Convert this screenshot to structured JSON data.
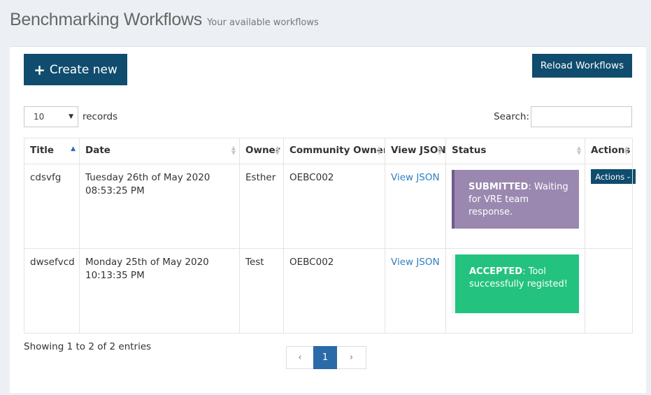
{
  "header": {
    "title": "Benchmarking Workflows",
    "subtitle": "Your available workflows"
  },
  "toolbar": {
    "create_label": "Create new",
    "reload_label": "Reload Workflows"
  },
  "length": {
    "value": "10",
    "label": "records"
  },
  "search": {
    "label": "Search:",
    "value": ""
  },
  "table": {
    "columns": [
      "Title",
      "Date",
      "Owner",
      "Community Owner",
      "View JSON",
      "Status",
      "Actions"
    ],
    "sorted_column": "Title",
    "rows": [
      {
        "title": "cdsvfg",
        "date": "Tuesday 26th of May 2020 08:53:25 PM",
        "owner": "Esther",
        "community_owner": "OEBC002",
        "json_link": "View JSON",
        "status_label": "SUBMITTED",
        "status_text": "Waiting for VRE team response.",
        "status_color": "#9a88b0",
        "actions_label": "Actions"
      },
      {
        "title": "dwsefvcd",
        "date": "Monday 25th of May 2020 10:13:35 PM",
        "owner": "Test",
        "community_owner": "OEBC002",
        "json_link": "View JSON",
        "status_label": "ACCEPTED",
        "status_text": "Tool successfully registed!",
        "status_color": "#23c27e",
        "actions_label": ""
      }
    ]
  },
  "footer": {
    "info": "Showing 1 to 2 of 2 entries",
    "pagination": {
      "prev": "‹",
      "current": "1",
      "next": "›"
    }
  },
  "colors": {
    "primary": "#0f4c6e",
    "link": "#2f7ec0",
    "page_active": "#2a6aa8"
  },
  "icons": {
    "create": "plus-icon",
    "length_select": "caret-down-icon",
    "sort": "sort-icon",
    "actions": "chevron-down-icon"
  }
}
